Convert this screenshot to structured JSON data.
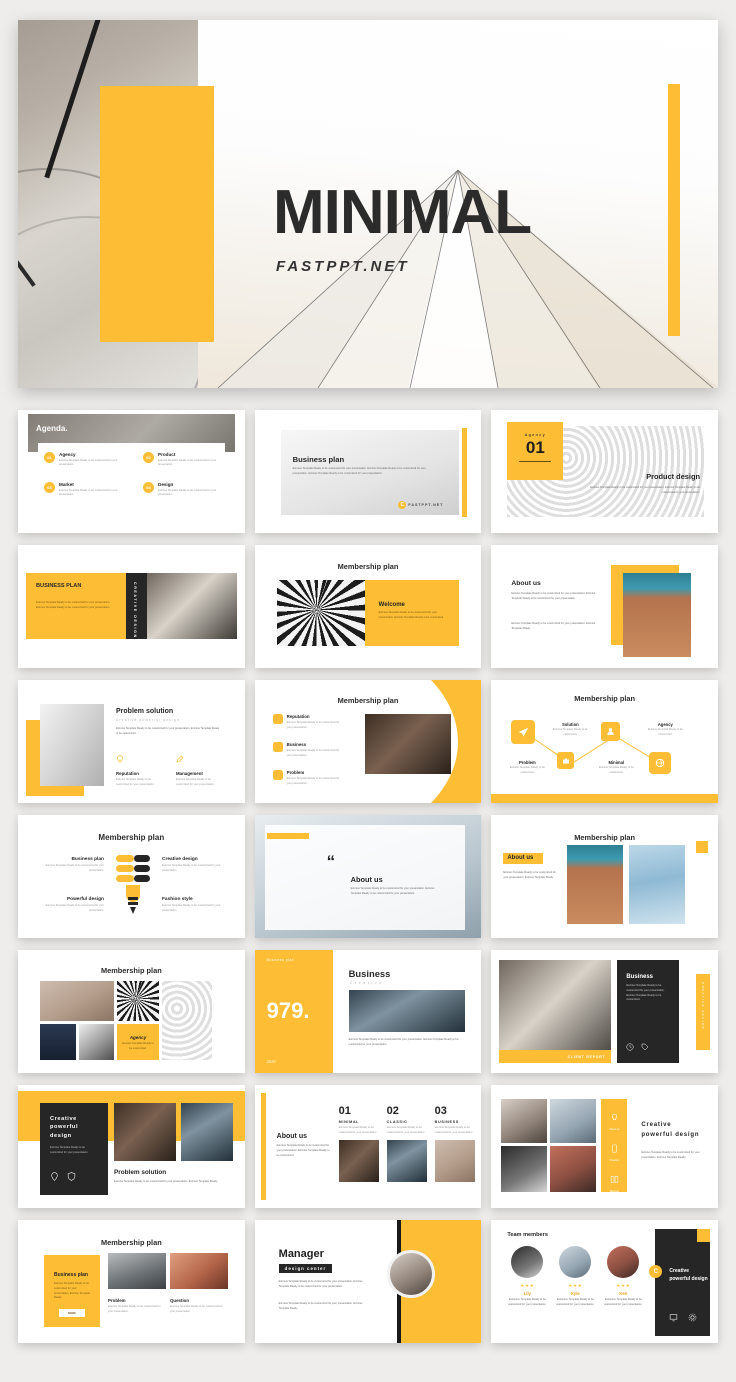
{
  "theme": {
    "accent": "#FDBE35",
    "dark": "#262626",
    "page_bg": "#EEEDEB",
    "text": "#2B2B2B",
    "muted": "#9A9A9A"
  },
  "hero": {
    "title": "MINIMAL",
    "subtitle": "FASTPPT.NET"
  },
  "slides": [
    {
      "id": "agenda",
      "title": "Agenda.",
      "items": [
        {
          "num": "01",
          "label": "Agency",
          "body": "Eximius Template Ready to be customized for your presentation."
        },
        {
          "num": "02",
          "label": "Product",
          "body": "Eximius Template Ready to be customized for your presentation."
        },
        {
          "num": "03",
          "label": "Market",
          "body": "Eximius Template Ready to be customized for your presentation."
        },
        {
          "num": "04",
          "label": "Design",
          "body": "Eximius Template Ready to be customized for your presentation."
        }
      ]
    },
    {
      "id": "business-plan-intro",
      "title": "Business plan",
      "body": "Eximius Template Ready to be customized for your presentation. Eximius Template Ready to be customized for your presentation. Eximius Template Ready to be customized for your presentation.",
      "logo": "FASTPPT.NET"
    },
    {
      "id": "product-design",
      "kicker": "Agency",
      "number": "01",
      "title": "Product design",
      "body": "Eximius Template Ready to be customized for your presentation. Eximius Template Ready to be customized for your presentation."
    },
    {
      "id": "business-plan-dark",
      "title": "BUSINESS PLAN",
      "vertical": "CREATIVE DESIGN",
      "body": "Eximius Template Ready to be customized for your presentation. Eximius Template Ready to be customized for your presentation."
    },
    {
      "id": "membership-welcome",
      "title": "Membership plan",
      "card_title": "Welcome",
      "body": "Eximius Template Ready to be customized for your presentation. Eximius Template Ready to be customized."
    },
    {
      "id": "about-us-photo",
      "title": "About us",
      "body1": "Eximius Template Ready to be customized for your presentation. Eximius Template Ready to be customized for your presentation.",
      "body2": "Eximius Template Ready to be customized for your presentation. Eximius Template Ready."
    },
    {
      "id": "problem-solution",
      "title": "Problem solution",
      "subtitle": "Creative powerful design",
      "body": "Eximius Template Ready to be customized for your presentation. Eximius Template Ready to be customized.",
      "items": [
        {
          "icon": "bulb-icon",
          "label": "Reputation",
          "body": "Eximius Template Ready to be customized for your presentation."
        },
        {
          "icon": "pencil-icon",
          "label": "Management",
          "body": "Eximius Template Ready to be customized for your presentation."
        }
      ]
    },
    {
      "id": "membership-list",
      "title": "Membership plan",
      "items": [
        {
          "label": "Reputation",
          "body": "Eximius Template Ready to be customized for your presentation."
        },
        {
          "label": "Business",
          "body": "Eximius Template Ready to be customized for your presentation."
        },
        {
          "label": "Problem",
          "body": "Eximius Template Ready to be customized for your presentation."
        }
      ]
    },
    {
      "id": "membership-flow",
      "title": "Membership plan",
      "nodes": [
        {
          "icon": "send-icon",
          "label": "Problem",
          "body": "Eximius Template Ready to be customized."
        },
        {
          "icon": "case-icon",
          "label": "Solution",
          "body": "Eximius Template Ready to be customized."
        },
        {
          "icon": "people-icon",
          "label": "Minimal",
          "body": "Eximius Template Ready to be customized."
        },
        {
          "icon": "globe-icon",
          "label": "Agency",
          "body": "Eximius Template Ready to be customized."
        }
      ]
    },
    {
      "id": "membership-bulb",
      "title": "Membership plan",
      "items": [
        {
          "label": "Business plan",
          "body": "Eximius Template Ready to be customized for your presentation."
        },
        {
          "label": "Creative design",
          "body": "Eximius Template Ready to be customized for your presentation."
        },
        {
          "label": "Powerful design",
          "body": "Eximius Template Ready to be customized for your presentation."
        },
        {
          "label": "Fashion style",
          "body": "Eximius Template Ready to be customized for your presentation."
        }
      ]
    },
    {
      "id": "about-us-quote",
      "quote_mark": "“",
      "title": "About us",
      "body": "Eximius Template Ready to be customized for your presentation. Eximius Template Ready to be customized for your presentation."
    },
    {
      "id": "membership-about",
      "title": "Membership plan",
      "tag": "About us",
      "body": "Eximius Template Ready to be customized for your presentation. Eximius Template Ready."
    },
    {
      "id": "membership-gallery",
      "title": "Membership plan",
      "card_label": "Agency",
      "card_body": "Eximius Template Ready to be customized."
    },
    {
      "id": "business-979",
      "kicker": "Business plan",
      "number": "979.",
      "year": "2022",
      "title": "Business",
      "subtitle": "Creative",
      "body": "Eximius Template Ready to be customized for your presentation. Eximius Template Ready to be customized for your presentation."
    },
    {
      "id": "business-dark",
      "title": "Business",
      "banner": "CLIENT REPORT",
      "vertical": "CREATIVE DESIGN",
      "body": "Eximius Template Ready to be customized for your presentation. Eximius Template Ready to be customized."
    },
    {
      "id": "creative-powerful",
      "title": "Creative powerful design",
      "body": "Eximius Template Ready to be customized for your presentation.",
      "section_title": "Problem solution",
      "section_body": "Eximius Template Ready to be customized for your presentation. Eximius Template Ready."
    },
    {
      "id": "about-us-numbers",
      "title": "About us",
      "body": "Eximius Template Ready to be customized for your presentation. Eximius Template Ready to be customized.",
      "columns": [
        {
          "num": "01",
          "label": "MINIMAL",
          "body": "Eximius Template Ready to be customized for your presentation."
        },
        {
          "num": "02",
          "label": "CLASSIC",
          "body": "Eximius Template Ready to be customized for your presentation."
        },
        {
          "num": "03",
          "label": "BUSINESS",
          "body": "Eximius Template Ready to be customized for your presentation."
        }
      ]
    },
    {
      "id": "creative-powerful-people",
      "title": "Creative powerful design",
      "body": "Eximius Template Ready to be customized for your presentation. Eximius Template Ready.",
      "rail": [
        {
          "icon": "lamp-icon",
          "label": "About us"
        },
        {
          "icon": "phone-icon",
          "label": "Creative"
        },
        {
          "icon": "book-icon",
          "label": "Minimal"
        }
      ]
    },
    {
      "id": "membership-business-card",
      "title": "Membership plan",
      "card_title": "Business plan",
      "card_body": "Eximius Template Ready to be customized for your presentation. Eximius Template Ready.",
      "card_button": "MORE",
      "items": [
        {
          "label": "Problem",
          "body": "Eximius Template Ready to be customized for your presentation."
        },
        {
          "label": "Question",
          "body": "Eximius Template Ready to be customized for your presentation."
        }
      ]
    },
    {
      "id": "manager",
      "title": "Manager",
      "tag": "design center",
      "body1": "Eximius Template Ready to be customized for your presentation. Eximius Template Ready to be customized for your presentation.",
      "body2": "Eximius Template Ready to be customized for your presentation. Eximius Template Ready."
    },
    {
      "id": "team-members",
      "title": "Team members",
      "panel_title": "Creative powerful design",
      "members": [
        {
          "name": "Lily",
          "stars": "★★★",
          "body": "Exclusive Template Ready to be customized for your presentation."
        },
        {
          "name": "Kyle",
          "stars": "★★★",
          "body": "Exclusive Template Ready to be customized for your presentation."
        },
        {
          "name": "Ken",
          "stars": "★★★",
          "body": "Exclusive Template Ready to be customized for your presentation."
        }
      ]
    }
  ]
}
